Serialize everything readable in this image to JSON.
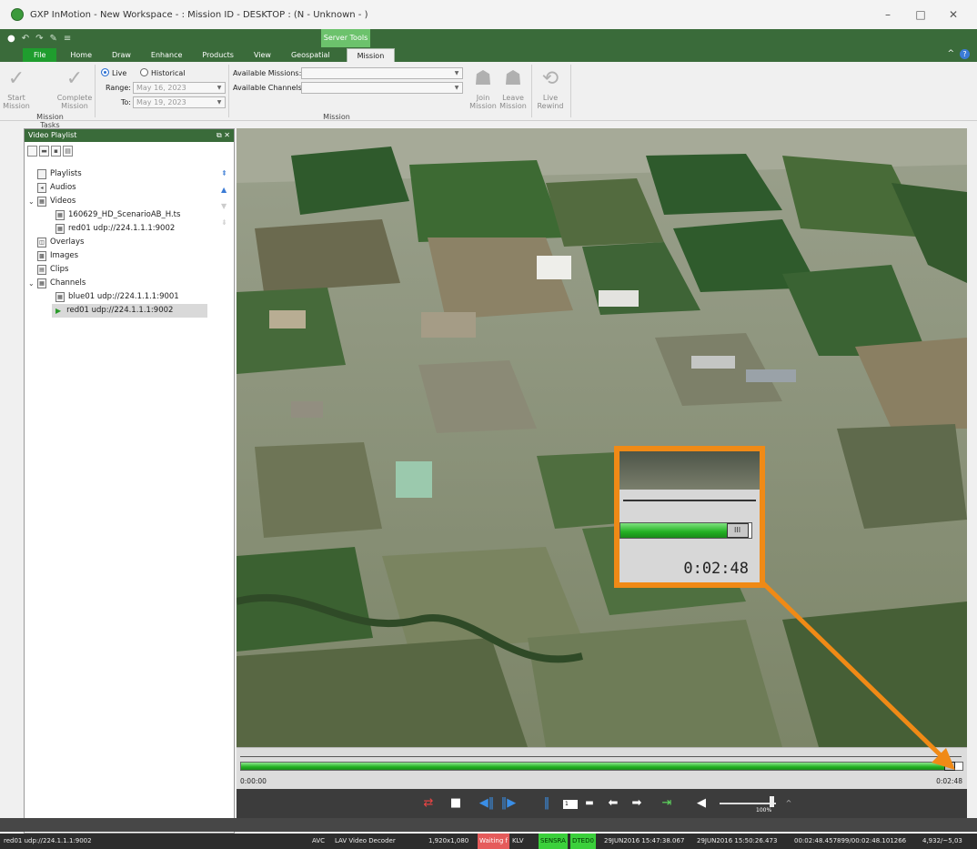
{
  "window": {
    "title": "GXP InMotion - New Workspace -  : Mission ID - DESKTOP : (N - Unknown - )"
  },
  "ribbon": {
    "contextual_tab": "Server Tools",
    "tabs": [
      "File",
      "Home",
      "Draw",
      "Enhance",
      "Products",
      "View",
      "Geospatial",
      "Mission"
    ],
    "active_tab": "Mission",
    "mission_tasks": {
      "start": "Start Mission",
      "complete": "Complete Mission",
      "group_label": "Mission Tasks"
    },
    "mode": {
      "live": "Live",
      "historical": "Historical",
      "selected": "Live"
    },
    "range_label": "Range:",
    "range_value": "May 16, 2023",
    "to_label": "To:",
    "to_value": "May 19, 2023",
    "available_missions_label": "Available Missions:",
    "available_channels_label": "Available Channels:",
    "join": "Join Mission",
    "leave": "Leave Mission",
    "live_rewind": "Live Rewind",
    "mission_group_label": "Mission"
  },
  "playlist": {
    "title": "Video Playlist",
    "items": [
      {
        "label": "Playlists",
        "icon": "playlist-icon"
      },
      {
        "label": "Audios",
        "icon": "audio-icon"
      },
      {
        "label": "Videos",
        "icon": "video-folder-icon"
      },
      {
        "label": "160629_HD_ScenarioAB_H.ts",
        "icon": "video-file-icon"
      },
      {
        "label": "red01 udp://224.1.1.1:9002",
        "icon": "video-file-icon"
      },
      {
        "label": "Overlays",
        "icon": "overlay-icon"
      },
      {
        "label": "Images",
        "icon": "image-icon"
      },
      {
        "label": "Clips",
        "icon": "clip-icon"
      },
      {
        "label": "Channels",
        "icon": "channel-folder-icon"
      },
      {
        "label": "blue01 udp://224.1.1.1:9001",
        "icon": "channel-icon"
      },
      {
        "label": "red01 udp://224.1.1.1:9002",
        "icon": "play-icon"
      }
    ]
  },
  "player": {
    "progress": 0.99,
    "time_start": "0:00:00",
    "time_end": "0:02:48",
    "callout_time": "0:02:48",
    "frame_step": "1",
    "volume_label": "100%",
    "volume": 0.88
  },
  "status": {
    "stream": "red01 udp://224.1.1.1:9002",
    "codec": "AVC",
    "decoder": "LAV Video Decoder",
    "resolution": "1,920x1,080",
    "waiting": "Waiting f",
    "klv": "KLV",
    "sensra": "SENSRA",
    "dted": "DTED0",
    "timestamp_start": "29JUN2016 15:47:38.067",
    "timestamp_end": "29JUN2016 15:50:26.473",
    "elapsed": "00:02:48.457899/00:02:48.101266",
    "frames": "4,932/~5,03"
  },
  "colors": {
    "callout": "#f08a16",
    "progress": "#22b022",
    "ribbon": "#3a6b3a"
  }
}
